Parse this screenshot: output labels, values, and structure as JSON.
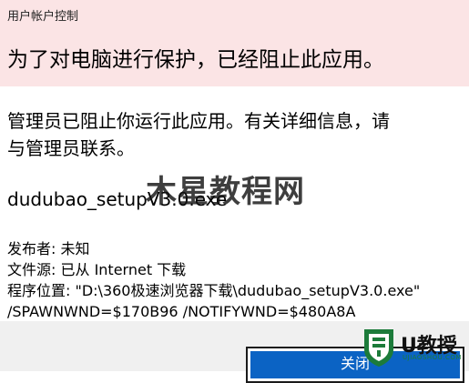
{
  "dialog": {
    "caption": "用户帐户控制",
    "headline": "为了对电脑进行保护，已经阻止此应用。",
    "message": "管理员已阻止你运行此应用。有关详细信息，请与管理员联系。",
    "filename": "dudubao_setupV3.0.exe",
    "details": {
      "publisher": "发布者: 未知",
      "source": "文件源: 已从 Internet 下载",
      "path": "程序位置: \"D:\\360极速浏览器下载\\dudubao_setupV3.0.exe\" /SPAWNWND=$170B96 /NOTIFYWND=$480A8A"
    },
    "close_label": "关闭"
  },
  "watermark": {
    "center_text": "木星教程网",
    "logo_text": "U教授",
    "logo_sub": "UJIAOSHOU.COM"
  },
  "colors": {
    "header_bg": "#fbe4e5",
    "button_bg": "#0b63c4",
    "logo_green": "#1c7b3a"
  }
}
